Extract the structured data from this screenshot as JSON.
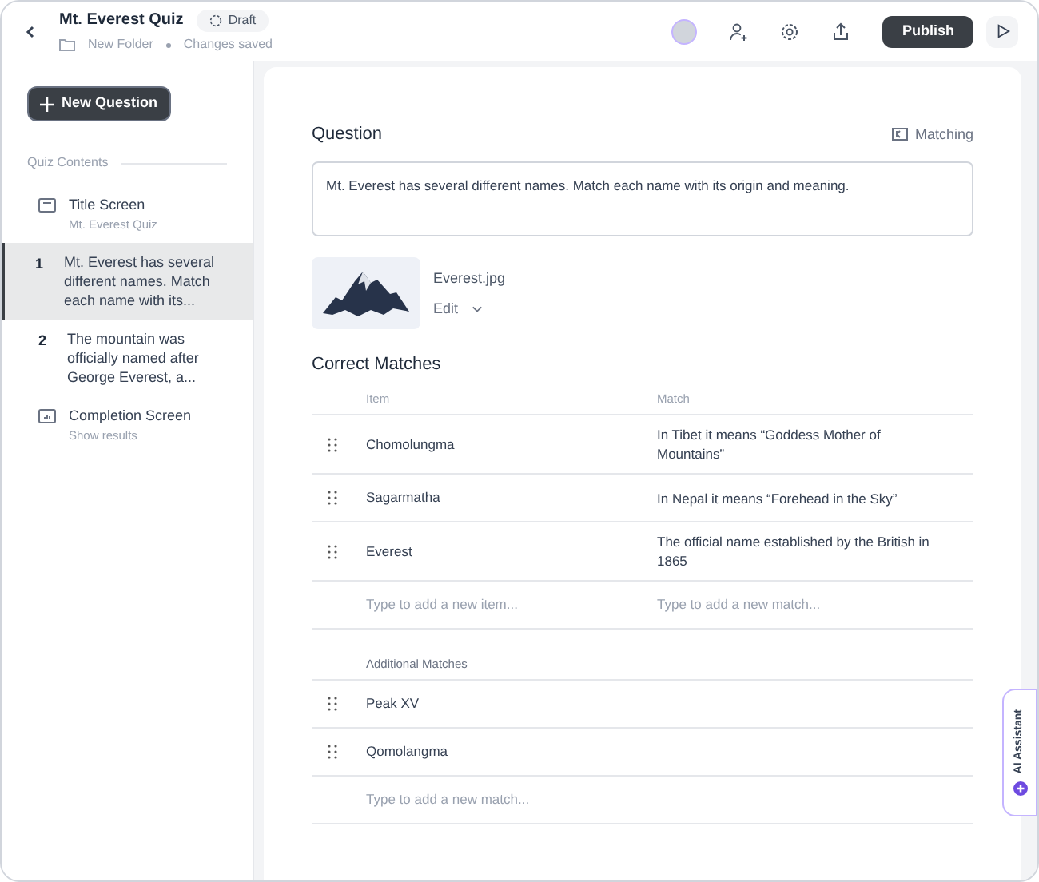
{
  "header": {
    "title": "Mt. Everest Quiz",
    "status": "Draft",
    "folder": "New Folder",
    "saved": "Changes saved",
    "publish": "Publish"
  },
  "sidebar": {
    "new_button": "New Question",
    "section": "Quiz Contents",
    "items": [
      {
        "kind": "title",
        "title": "Title Screen",
        "subtitle": "Mt. Everest Quiz",
        "selected": false
      },
      {
        "kind": "question",
        "number": "1",
        "title": "Mt. Everest has several different names. Match each name with its...",
        "selected": true
      },
      {
        "kind": "question",
        "number": "2",
        "title": "The mountain was officially named after George Everest, a...",
        "selected": false
      },
      {
        "kind": "completion",
        "title": "Completion Screen",
        "subtitle": "Show results",
        "selected": false
      }
    ]
  },
  "editor": {
    "heading": "Question",
    "type": "Matching",
    "question": "Mt. Everest has several different names. Match each name with its origin and meaning.",
    "image": {
      "filename": "Everest.jpg",
      "edit": "Edit"
    },
    "matches_heading": "Correct Matches",
    "columns": [
      "Item",
      "Match"
    ],
    "rows": [
      {
        "item": "Chomolungma",
        "match": "In Tibet it means “Goddess Mother of Mountains”"
      },
      {
        "item": "Sagarmatha",
        "match": "In Nepal it means “Forehead in the Sky”"
      },
      {
        "item": "Everest",
        "match": "The official name established by the British in 1865"
      }
    ],
    "new_item_placeholder": "Type to add a new item...",
    "new_match_placeholder": "Type to add a new match...",
    "additional_heading": "Additional Matches",
    "additional": [
      "Peak XV",
      "Qomolangma"
    ],
    "additional_placeholder": "Type to add a new match..."
  },
  "assistant": "AI Assistant"
}
